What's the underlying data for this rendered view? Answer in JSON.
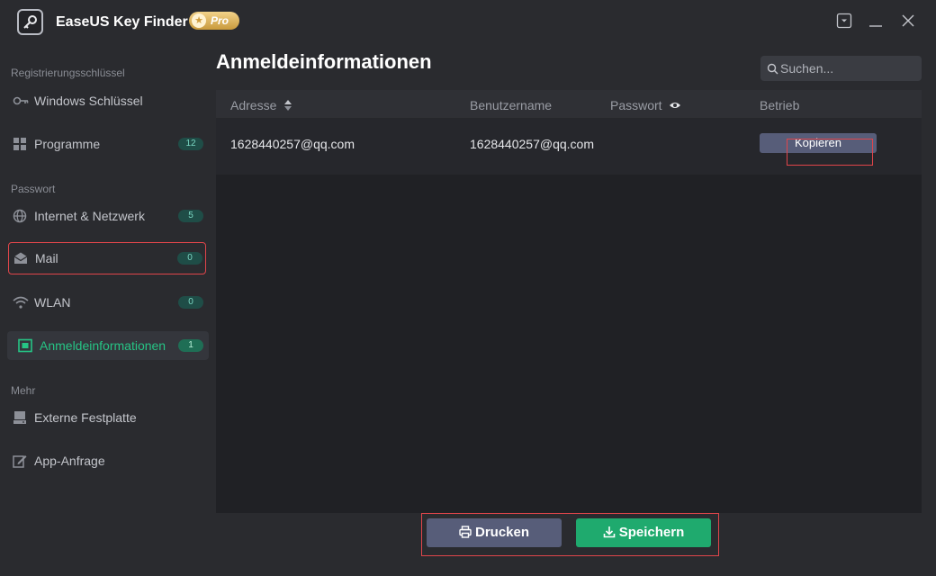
{
  "app": {
    "title": "EaseUS Key Finder",
    "badge": "Pro"
  },
  "sidebar": {
    "sections": [
      {
        "label": "Registrierungsschlüssel"
      },
      {
        "label": "Passwort"
      },
      {
        "label": "Mehr"
      }
    ],
    "items": [
      {
        "label": "Windows Schlüssel",
        "icon": "key-icon"
      },
      {
        "label": "Programme",
        "count": "12",
        "icon": "grid-icon"
      },
      {
        "label": "Internet & Netzwerk",
        "count": "5",
        "icon": "globe-icon"
      },
      {
        "label": "Mail",
        "count": "0",
        "icon": "mail-icon"
      },
      {
        "label": "WLAN",
        "count": "0",
        "icon": "wifi-icon"
      },
      {
        "label": "Anmeldeinformationen",
        "count": "1",
        "icon": "credential-icon"
      },
      {
        "label": "Externe Festplatte",
        "icon": "drive-icon"
      },
      {
        "label": "App-Anfrage",
        "icon": "edit-icon"
      }
    ]
  },
  "main": {
    "title": "Anmeldeinformationen",
    "search_placeholder": "Suchen...",
    "columns": [
      "Adresse",
      "Benutzername",
      "Passwort",
      "Betrieb"
    ],
    "rows": [
      {
        "address": "1628440257@qq.com",
        "username": "1628440257@qq.com",
        "password": "",
        "action": "Kopieren"
      }
    ]
  },
  "footer": {
    "print_label": "Drucken",
    "save_label": "Speichern"
  },
  "colors": {
    "accent": "#26c485",
    "save": "#1faa6e",
    "secondary_button": "#575d79",
    "highlight": "#e0454a"
  }
}
